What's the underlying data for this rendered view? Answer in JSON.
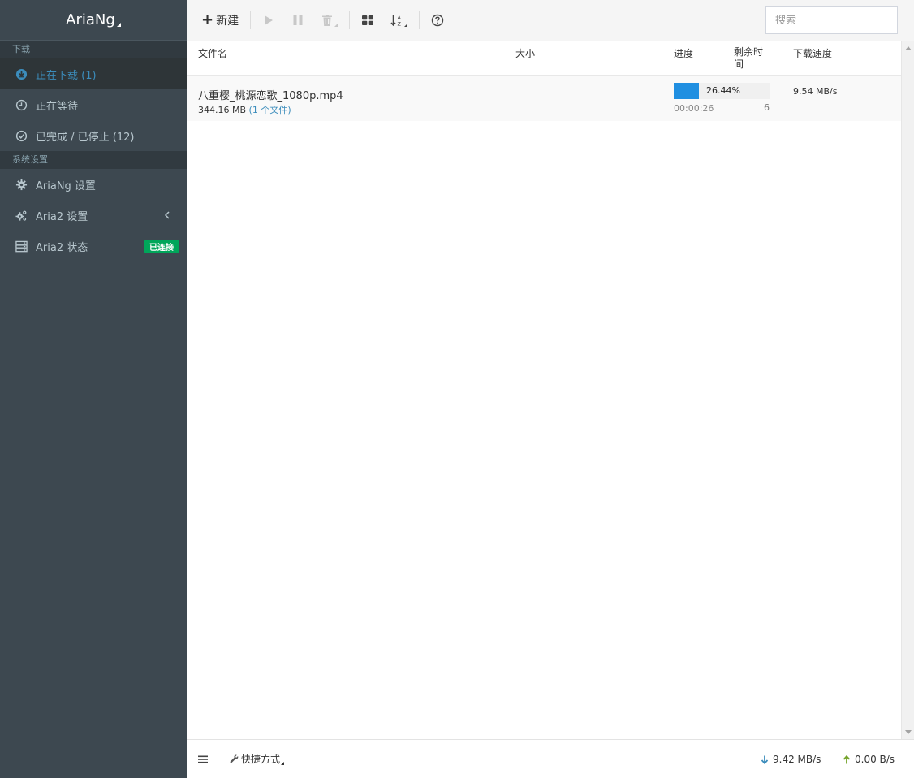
{
  "app": {
    "brand": "AriaNg"
  },
  "sidebar": {
    "section_download": "下载",
    "items": [
      {
        "label": "正在下载 (1)",
        "icon": "download-circle-icon",
        "active": true
      },
      {
        "label": "正在等待",
        "icon": "clock-icon"
      },
      {
        "label": "已完成 / 已停止 (12)",
        "icon": "check-circle-icon"
      }
    ],
    "section_settings": "系统设置",
    "settings_items": [
      {
        "label": "AriaNg 设置",
        "icon": "gear-icon"
      },
      {
        "label": "Aria2 设置",
        "icon": "gears-icon",
        "has_chevron": true
      },
      {
        "label": "Aria2 状态",
        "icon": "server-icon",
        "badge": "已连接"
      }
    ]
  },
  "toolbar": {
    "new_label": "新建",
    "search_placeholder": "搜索"
  },
  "table": {
    "headers": {
      "name": "文件名",
      "size": "大小",
      "progress": "进度",
      "remaining": "剩余时间",
      "speed": "下载速度"
    },
    "rows": [
      {
        "name": "八重樱_桃源恋歌_1080p.mp4",
        "size": "344.16 MB",
        "files": "(1 个文件)",
        "progress_text": "26.44%",
        "progress_fraction": 0.2644,
        "remaining": "00:00:26",
        "connections": "6",
        "download_speed": "9.54 MB/s"
      }
    ]
  },
  "footer": {
    "shortcuts_label": "快捷方式",
    "download_speed": "9.42 MB/s",
    "upload_speed": "0.00 B/s"
  },
  "colors": {
    "sidebar_bg": "#3d4850",
    "accent": "#3c8dbc",
    "progress": "#208fe1",
    "badge": "#00a65a"
  }
}
